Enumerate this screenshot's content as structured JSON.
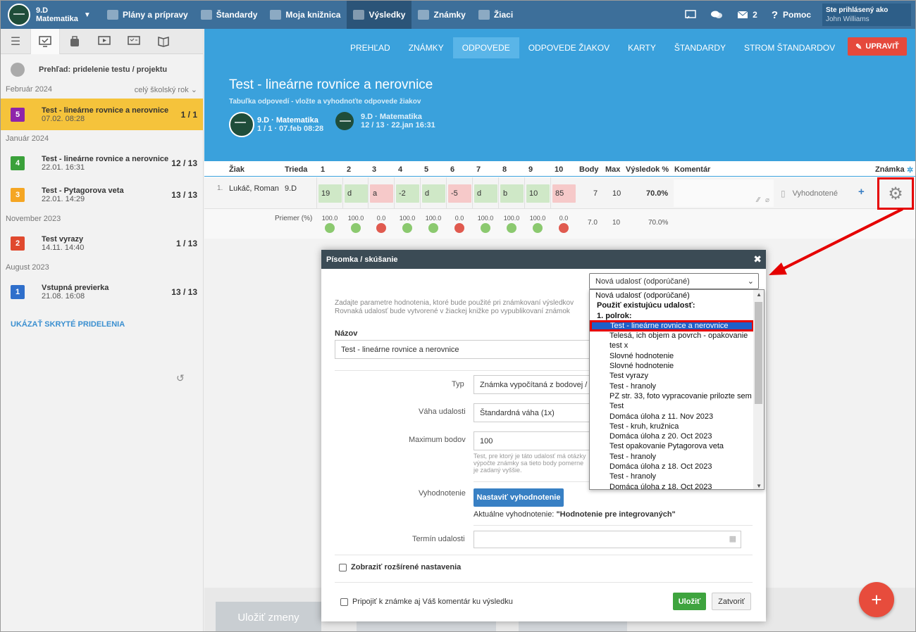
{
  "topbar": {
    "class_name": "9.D",
    "class_subject": "Matematika",
    "nav": [
      {
        "label": "Plány a prípravy",
        "icon": "briefcase-icon"
      },
      {
        "label": "Štandardy",
        "icon": "shield-icon"
      },
      {
        "label": "Moja knižnica",
        "icon": "library-icon"
      },
      {
        "label": "Výsledky",
        "icon": "bar-chart-icon",
        "active": true
      },
      {
        "label": "Známky",
        "icon": "grade-icon"
      },
      {
        "label": "Žiaci",
        "icon": "students-icon"
      }
    ],
    "messages_count": "2",
    "help_label": "Pomoc",
    "signed_in_label": "Ste prihlásený ako",
    "user_name": "John Williams"
  },
  "sidebar": {
    "header": "Prehľad: pridelenie testu / projektu",
    "filter": "celý školský rok",
    "show_hidden": "UKÁZAŤ SKRYTÉ PRIDELENIA",
    "groups": [
      {
        "month": "Február 2024",
        "items": [
          {
            "num": "5",
            "color": "#8e24aa",
            "title": "Test - lineárne rovnice a nerovnice",
            "date": "07.02. 08:28",
            "count": "1 / 1",
            "selected": true
          }
        ]
      },
      {
        "month": "Január 2024",
        "items": [
          {
            "num": "4",
            "color": "#3aa13a",
            "title": "Test - lineárne rovnice a nerovnice",
            "date": "22.01. 16:31",
            "count": "12 / 13"
          },
          {
            "num": "3",
            "color": "#f5a623",
            "title": "Test - Pytagorova veta",
            "date": "22.01. 14:29",
            "count": "13 / 13"
          }
        ]
      },
      {
        "month": "November 2023",
        "items": [
          {
            "num": "2",
            "color": "#e0492e",
            "title": "Test vyrazy",
            "date": "14.11. 14:40",
            "count": "1 / 13"
          }
        ]
      },
      {
        "month": "August 2023",
        "items": [
          {
            "num": "1",
            "color": "#2f6fcb",
            "title": "Vstupná previerka",
            "date": "21.08. 16:08",
            "count": "13 / 13"
          }
        ]
      }
    ]
  },
  "main": {
    "tabs": [
      "PREHĽAD",
      "ZNÁMKY",
      "ODPOVEDE",
      "ODPOVEDE ŽIAKOV",
      "KARTY",
      "ŠTANDARDY",
      "STROM ŠTANDARDOV"
    ],
    "active_tab": 2,
    "edit_label": "UPRAVIŤ",
    "title": "Test - lineárne rovnice a nerovnice",
    "subtitle": "Tabuľka odpovedí - vložte a vyhodnoťte odpovede žiakov",
    "cards": [
      {
        "name": "9.D · Matematika",
        "meta": "1 / 1 · 07.feb 08:28"
      },
      {
        "name": "9.D · Matematika",
        "meta": "12 / 13 · 22.jan 16:31"
      }
    ]
  },
  "table": {
    "headers": {
      "student": "Žiak",
      "class": "Trieda",
      "q": [
        "1",
        "2",
        "3",
        "4",
        "5",
        "6",
        "7",
        "8",
        "9",
        "10"
      ],
      "points": "Body",
      "max": "Max",
      "result": "Výsledok %",
      "comment": "Komentár",
      "grade": "Známka"
    },
    "row": {
      "index": "1.",
      "student": "Lukáč, Roman",
      "class": "9.D",
      "answers": [
        {
          "v": "19",
          "ok": true
        },
        {
          "v": "d",
          "ok": true
        },
        {
          "v": "a",
          "ok": false
        },
        {
          "v": "-2",
          "ok": true
        },
        {
          "v": "d",
          "ok": true
        },
        {
          "v": "-5",
          "ok": false
        },
        {
          "v": "d",
          "ok": true
        },
        {
          "v": "b",
          "ok": true
        },
        {
          "v": "10",
          "ok": true
        },
        {
          "v": "85",
          "ok": false
        }
      ],
      "points": "7",
      "max": "10",
      "result": "70.0%",
      "status": "Vyhodnotené"
    },
    "average_label": "Priemer (%)",
    "averages": [
      {
        "v": "100.0",
        "ok": true
      },
      {
        "v": "100.0",
        "ok": true
      },
      {
        "v": "0.0",
        "ok": false
      },
      {
        "v": "100.0",
        "ok": true
      },
      {
        "v": "100.0",
        "ok": true
      },
      {
        "v": "0.0",
        "ok": false
      },
      {
        "v": "100.0",
        "ok": true
      },
      {
        "v": "100.0",
        "ok": true
      },
      {
        "v": "100.0",
        "ok": true
      },
      {
        "v": "0.0",
        "ok": false
      }
    ],
    "avg_points": "7.0",
    "avg_max": "10",
    "avg_result": "70.0%"
  },
  "bottom": {
    "save_changes": "Uložiť zmeny"
  },
  "modal": {
    "title": "Písomka / skúšanie",
    "event_select": "Nová udalosť (odporúčané)",
    "info_line1": "Zadajte parametre hodnotenia, ktoré bude použité pri známkovaní výsledkov",
    "info_line2": "Rovnaká udalosť bude vytvorené v žiackej knižke po vypublikovaní známok",
    "name_label": "Názov",
    "name_value": "Test - lineárne rovnice a nerovnice",
    "type_label": "Typ",
    "type_value": "Známka vypočítaná z bodovej / percentuálnej",
    "weight_label": "Váha udalosti",
    "weight_value": "Štandardná váha (1x)",
    "max_label": "Maximum bodov",
    "max_value": "100",
    "max_hint1": "Test, pre ktorý je táto udalosť má otázky",
    "max_hint2": "výpočte známky sa tieto body pomerne",
    "max_hint3": "je zadaný vyššie.",
    "eval_label": "Vyhodnotenie",
    "eval_button": "Nastaviť vyhodnotenie",
    "current_eval_prefix": "Aktuálne vyhodnotenie:",
    "current_eval_value": "\"Hodnotenie pre integrovaných\"",
    "date_label": "Termín udalosti",
    "advanced_label": "Zobraziť rozšírené nastavenia",
    "attach_comment_label": "Pripojiť k známke aj Váš komentár ku výsledku",
    "save_label": "Uložiť",
    "close_label": "Zatvoriť"
  },
  "dropdown": {
    "items": [
      {
        "label": "Nová udalosť (odporúčané)",
        "kind": "plain"
      },
      {
        "label": "Použiť existujúcu udalosť:",
        "kind": "grp"
      },
      {
        "label": "1. polrok:",
        "kind": "grp"
      },
      {
        "label": "Test - lineárne rovnice a nerovnice",
        "kind": "hl"
      },
      {
        "label": "Telesá, ich objem a povrch - opakovanie",
        "kind": "opt"
      },
      {
        "label": "test x",
        "kind": "opt"
      },
      {
        "label": "Slovné hodnotenie",
        "kind": "opt"
      },
      {
        "label": "Slovné hodnotenie",
        "kind": "opt"
      },
      {
        "label": "Test vyrazy",
        "kind": "opt"
      },
      {
        "label": "Test - hranoly",
        "kind": "opt"
      },
      {
        "label": "PZ str. 33, foto vypracovanie prilozte sem",
        "kind": "opt"
      },
      {
        "label": "Test",
        "kind": "opt"
      },
      {
        "label": "Domáca úloha z 11. Nov 2023",
        "kind": "opt"
      },
      {
        "label": "Test - kruh, kružnica",
        "kind": "opt"
      },
      {
        "label": "Domáca úloha z 20. Oct 2023",
        "kind": "opt"
      },
      {
        "label": "Test opakovanie Pytagorova veta",
        "kind": "opt"
      },
      {
        "label": "Test - hranoly",
        "kind": "opt"
      },
      {
        "label": "Domáca úloha z 18. Oct 2023",
        "kind": "opt"
      },
      {
        "label": "Test - hranoly",
        "kind": "opt"
      },
      {
        "label": "Domáca úloha z 18. Oct 2023",
        "kind": "opt"
      }
    ]
  }
}
